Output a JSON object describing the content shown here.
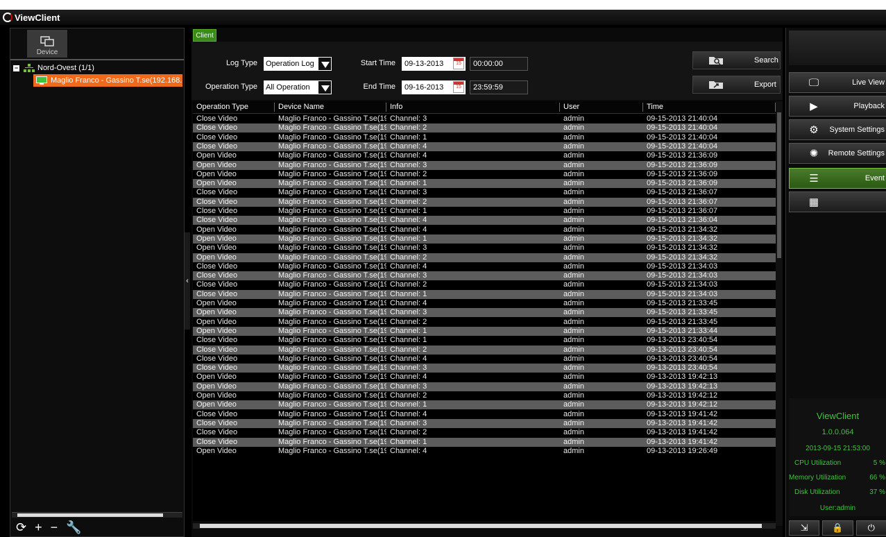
{
  "app": {
    "title": "ViewClient"
  },
  "left": {
    "device_tab": "Device",
    "group": "Nord-Ovest (1/1)",
    "device": "Maglio Franco - Gassino T.se(192.168.2"
  },
  "center": {
    "tab": "Client",
    "log_type_label": "Log Type",
    "log_type_value": "Operation Log",
    "operation_type_label": "Operation Type",
    "operation_type_value": "All Operation",
    "start_time_label": "Start Time",
    "start_date": "09-13-2013",
    "start_time": "00:00:00",
    "end_time_label": "End Time",
    "end_date": "09-16-2013",
    "end_time": "23:59:59",
    "search_label": "Search",
    "export_label": "Export",
    "cal_num": "15"
  },
  "table": {
    "headers": [
      "Operation Type",
      "Device Name",
      "Info",
      "User",
      "Time"
    ],
    "device_name": "Maglio Franco - Gassino T.se(19:",
    "rows": [
      [
        "Close Video",
        "Channel: 3",
        "admin",
        "09-15-2013 21:40:04"
      ],
      [
        "Close Video",
        "Channel: 2",
        "admin",
        "09-15-2013 21:40:04"
      ],
      [
        "Close Video",
        "Channel: 1",
        "admin",
        "09-15-2013 21:40:04"
      ],
      [
        "Close Video",
        "Channel: 4",
        "admin",
        "09-15-2013 21:40:04"
      ],
      [
        "Open Video",
        "Channel: 4",
        "admin",
        "09-15-2013 21:36:09"
      ],
      [
        "Open Video",
        "Channel: 3",
        "admin",
        "09-15-2013 21:36:09"
      ],
      [
        "Open Video",
        "Channel: 2",
        "admin",
        "09-15-2013 21:36:09"
      ],
      [
        "Open Video",
        "Channel: 1",
        "admin",
        "09-15-2013 21:36:09"
      ],
      [
        "Close Video",
        "Channel: 3",
        "admin",
        "09-15-2013 21:36:07"
      ],
      [
        "Close Video",
        "Channel: 2",
        "admin",
        "09-15-2013 21:36:07"
      ],
      [
        "Close Video",
        "Channel: 1",
        "admin",
        "09-15-2013 21:36:07"
      ],
      [
        "Close Video",
        "Channel: 4",
        "admin",
        "09-15-2013 21:36:04"
      ],
      [
        "Open Video",
        "Channel: 4",
        "admin",
        "09-15-2013 21:34:32"
      ],
      [
        "Open Video",
        "Channel: 1",
        "admin",
        "09-15-2013 21:34:32"
      ],
      [
        "Open Video",
        "Channel: 3",
        "admin",
        "09-15-2013 21:34:32"
      ],
      [
        "Open Video",
        "Channel: 2",
        "admin",
        "09-15-2013 21:34:32"
      ],
      [
        "Close Video",
        "Channel: 4",
        "admin",
        "09-15-2013 21:34:03"
      ],
      [
        "Close Video",
        "Channel: 3",
        "admin",
        "09-15-2013 21:34:03"
      ],
      [
        "Close Video",
        "Channel: 2",
        "admin",
        "09-15-2013 21:34:03"
      ],
      [
        "Close Video",
        "Channel: 1",
        "admin",
        "09-15-2013 21:34:03"
      ],
      [
        "Open Video",
        "Channel: 4",
        "admin",
        "09-15-2013 21:33:45"
      ],
      [
        "Open Video",
        "Channel: 3",
        "admin",
        "09-15-2013 21:33:45"
      ],
      [
        "Open Video",
        "Channel: 2",
        "admin",
        "09-15-2013 21:33:45"
      ],
      [
        "Open Video",
        "Channel: 1",
        "admin",
        "09-15-2013 21:33:44"
      ],
      [
        "Close Video",
        "Channel: 1",
        "admin",
        "09-13-2013 23:40:54"
      ],
      [
        "Close Video",
        "Channel: 2",
        "admin",
        "09-13-2013 23:40:54"
      ],
      [
        "Close Video",
        "Channel: 4",
        "admin",
        "09-13-2013 23:40:54"
      ],
      [
        "Close Video",
        "Channel: 3",
        "admin",
        "09-13-2013 23:40:54"
      ],
      [
        "Open Video",
        "Channel: 4",
        "admin",
        "09-13-2013 19:42:13"
      ],
      [
        "Open Video",
        "Channel: 3",
        "admin",
        "09-13-2013 19:42:13"
      ],
      [
        "Open Video",
        "Channel: 2",
        "admin",
        "09-13-2013 19:42:12"
      ],
      [
        "Open Video",
        "Channel: 1",
        "admin",
        "09-13-2013 19:42:12"
      ],
      [
        "Close Video",
        "Channel: 4",
        "admin",
        "09-13-2013 19:41:42"
      ],
      [
        "Close Video",
        "Channel: 3",
        "admin",
        "09-13-2013 19:41:42"
      ],
      [
        "Close Video",
        "Channel: 2",
        "admin",
        "09-13-2013 19:41:42"
      ],
      [
        "Close Video",
        "Channel: 1",
        "admin",
        "09-13-2013 19:41:42"
      ],
      [
        "Open Video",
        "Channel: 4",
        "admin",
        "09-13-2013 19:26:49"
      ]
    ]
  },
  "right": {
    "nav": [
      {
        "label": "Live View",
        "icon": "monitor-icon"
      },
      {
        "label": "Playback",
        "icon": "playback-icon"
      },
      {
        "label": "System Settings",
        "icon": "gear-icon"
      },
      {
        "label": "Remote Settings",
        "icon": "globe-gear-icon"
      },
      {
        "label": "Event",
        "icon": "list-icon"
      },
      {
        "label": "",
        "icon": "grid-icon"
      }
    ],
    "info": {
      "app": "ViewClient",
      "version": "1.0.0.064",
      "datetime": "2013-09-15 21:53:00",
      "cpu_label": "CPU Utilization",
      "cpu": "5 %",
      "mem_label": "Memory Utilization",
      "mem": "66 %",
      "disk_label": "Disk Utilization",
      "disk": "37 %",
      "user": "User:admin"
    }
  },
  "colors": {
    "accent_green": "#3fc43f",
    "selection_orange": "#f06a1c"
  }
}
